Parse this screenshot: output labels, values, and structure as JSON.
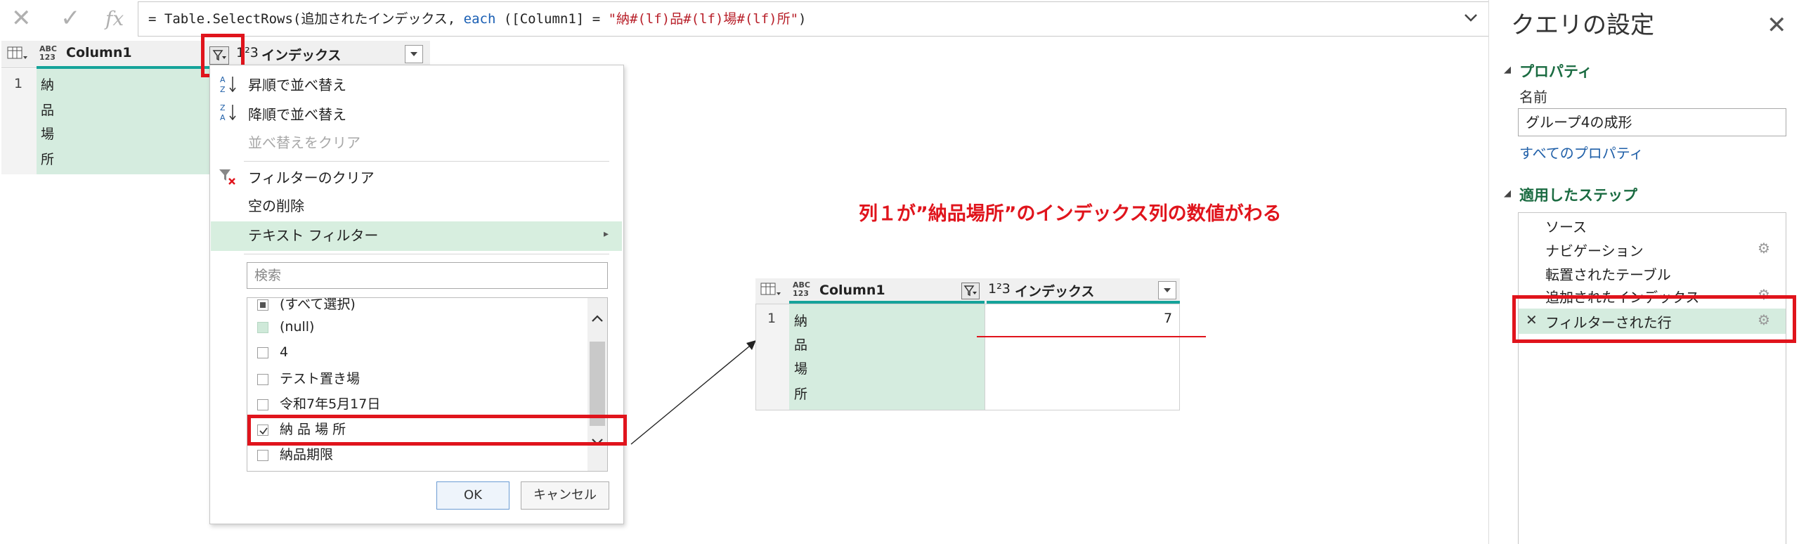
{
  "formula_bar": {
    "cancel_icon": "✕",
    "commit_icon": "✓",
    "fx_label": "fx",
    "formula_prefix": "= Table.SelectRows(追加されたインデックス, ",
    "formula_keyword": "each",
    "formula_mid": " ([Column1] = ",
    "formula_string": "\"納#(lf)品#(lf)場#(lf)所\"",
    "formula_suffix": ")",
    "expand_icon": "chevron-down"
  },
  "main_grid": {
    "type_label": "ABC\n123",
    "col1_header": "Column1",
    "col2_type": "1²3",
    "col2_header": "インデックス",
    "row_number": "1",
    "cell_lines": [
      "納",
      "品",
      "場",
      "所"
    ]
  },
  "filter_menu": {
    "sort_asc": "昇順で並べ替え",
    "sort_desc": "降順で並べ替え",
    "clear_sort": "並べ替えをクリア",
    "clear_filter": "フィルターのクリア",
    "remove_empty": "空の削除",
    "text_filter": "テキスト フィルター",
    "search_placeholder": "検索",
    "items": [
      {
        "label": "(すべて選択)",
        "state": "partial"
      },
      {
        "label": "(null)",
        "state": "empty-green"
      },
      {
        "label": "4",
        "state": "unchecked"
      },
      {
        "label": "テスト置き場",
        "state": "unchecked"
      },
      {
        "label": "令和7年5月17日",
        "state": "unchecked"
      },
      {
        "label": "納 品 場 所",
        "state": "checked"
      },
      {
        "label": "納品期限",
        "state": "unchecked"
      }
    ],
    "ok_label": "OK",
    "cancel_label": "キャンセル"
  },
  "annotation": {
    "text": "列１が”納品場所”のインデックス列の数値がわる",
    "color": "#e0141c"
  },
  "result_grid": {
    "type_label": "ABC\n123",
    "col1_header": "Column1",
    "col2_type": "1²3",
    "col2_header": "インデックス",
    "row_number": "1",
    "cell_lines": [
      "納",
      "品",
      "場",
      "所"
    ],
    "index_value": "7"
  },
  "query_settings": {
    "title": "クエリの設定",
    "close_icon": "✕",
    "properties_header": "プロパティ",
    "name_label": "名前",
    "name_value": "グループ4の成形",
    "all_properties_link": "すべてのプロパティ",
    "applied_steps_header": "適用したステップ",
    "steps": [
      {
        "label": "ソース",
        "gear": false
      },
      {
        "label": "ナビゲーション",
        "gear": true
      },
      {
        "label": "転置されたテーブル",
        "gear": false
      },
      {
        "label": "追加されたインデックス",
        "gear": true
      },
      {
        "label": "フィルターされた行",
        "gear": true,
        "selected": true
      }
    ],
    "delete_step_icon": "✕"
  },
  "colors": {
    "accent_teal": "#15a39a",
    "selected_green": "#d5ecdf",
    "highlight_red": "#e0141c",
    "section_green": "#1a6b41"
  }
}
